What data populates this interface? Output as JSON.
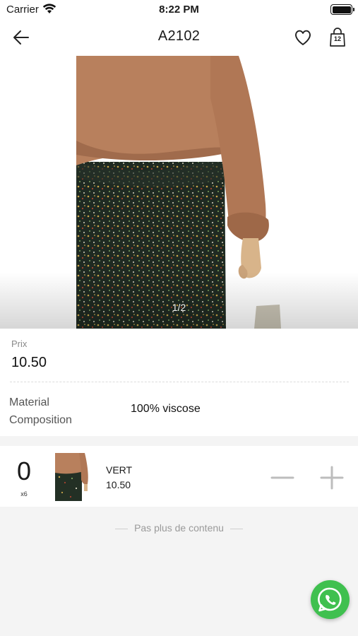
{
  "status_bar": {
    "carrier": "Carrier",
    "time": "8:22 PM"
  },
  "nav": {
    "title": "A2102",
    "cart_count": "12",
    "icons": {
      "back": "arrow-left-icon",
      "favorite": "heart-icon",
      "cart": "shopping-bag-icon"
    }
  },
  "hero": {
    "pager": "1/2"
  },
  "info": {
    "price_label": "Prix",
    "price_value": "10.50",
    "material_label": "Material Composition",
    "material_value": "100% viscose"
  },
  "variant": {
    "quantity": "0",
    "pack_size": "x6",
    "color_name": "VERT",
    "price": "10.50"
  },
  "footer": {
    "end_note": "Pas plus de contenu"
  },
  "colors": {
    "accent_whatsapp": "#3fc04f",
    "background": "#f4f4f4"
  }
}
